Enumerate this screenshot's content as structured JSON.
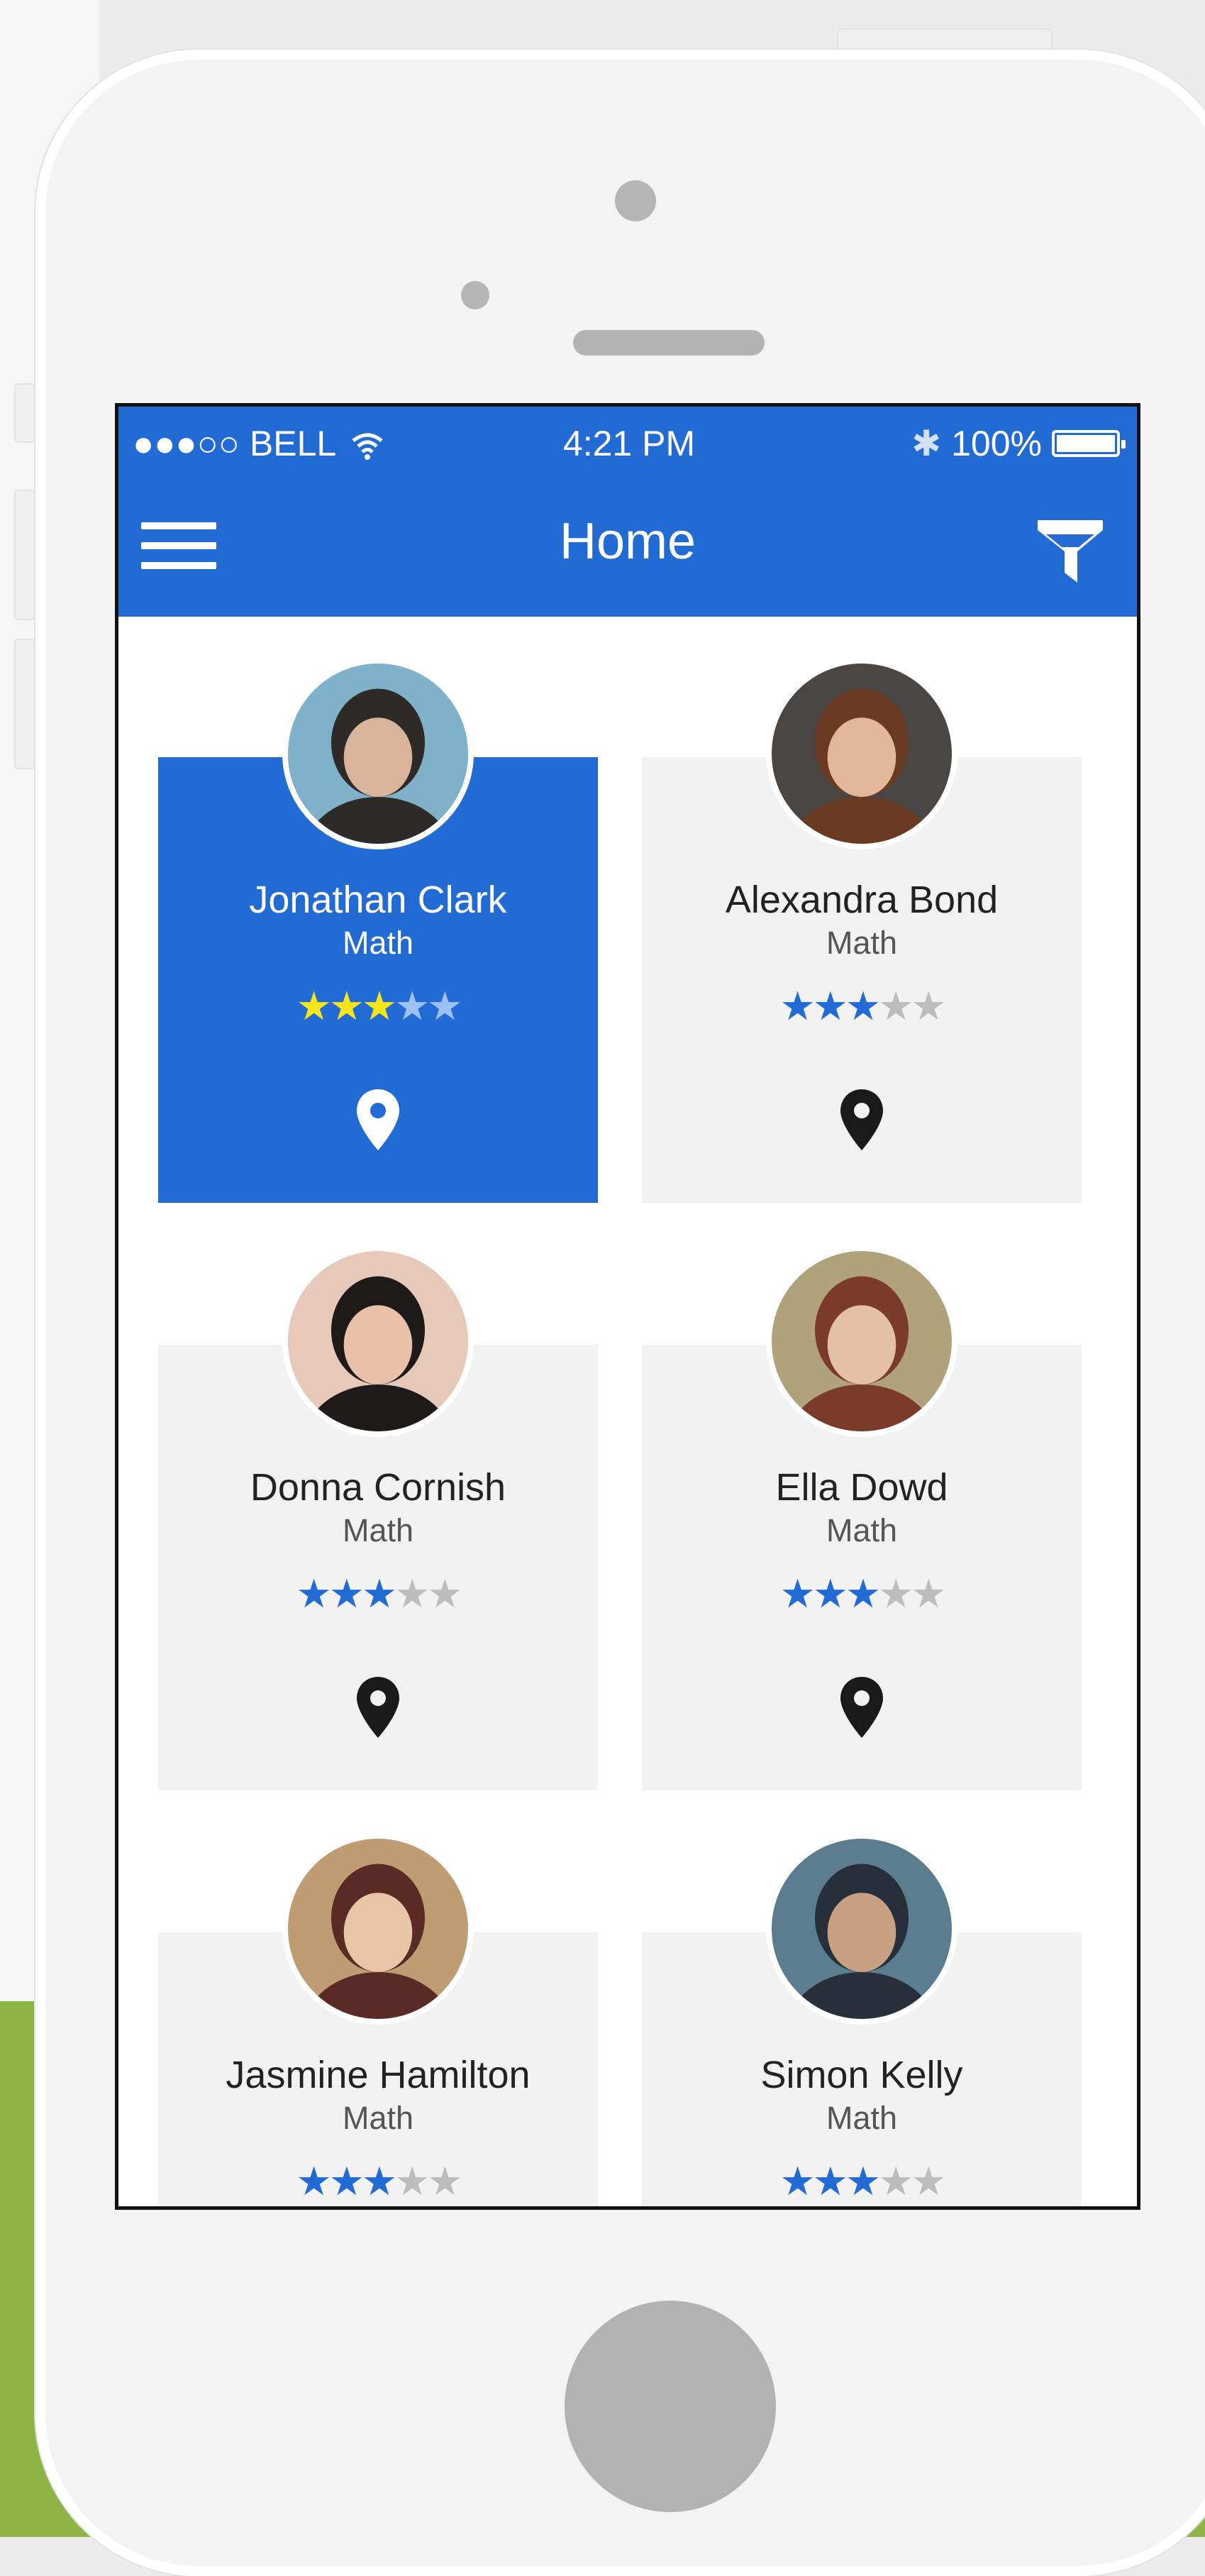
{
  "status_bar": {
    "carrier": "●●●○○ BELL",
    "time": "4:21 PM",
    "bluetooth": "✱",
    "battery": "100%"
  },
  "app_bar": {
    "title": "Home",
    "menu_icon": "hamburger-menu-icon",
    "filter_icon": "filter-funnel-icon"
  },
  "colors": {
    "accent": "#236bd4",
    "star_active_selected": "#f5e51b",
    "star_inactive": "#bdbdbd",
    "card_bg": "#f2f2f2"
  },
  "tutors": [
    {
      "name": "Jonathan Clark",
      "subject": "Math",
      "rating": 3,
      "selected": true
    },
    {
      "name": "Alexandra Bond",
      "subject": "Math",
      "rating": 3,
      "selected": false
    },
    {
      "name": "Donna Cornish",
      "subject": "Math",
      "rating": 3,
      "selected": false
    },
    {
      "name": "Ella Dowd",
      "subject": "Math",
      "rating": 3,
      "selected": false
    },
    {
      "name": "Jasmine Hamilton",
      "subject": "Math",
      "rating": 3,
      "selected": false
    },
    {
      "name": "Simon Kelly",
      "subject": "Math",
      "rating": 3,
      "selected": false
    }
  ]
}
